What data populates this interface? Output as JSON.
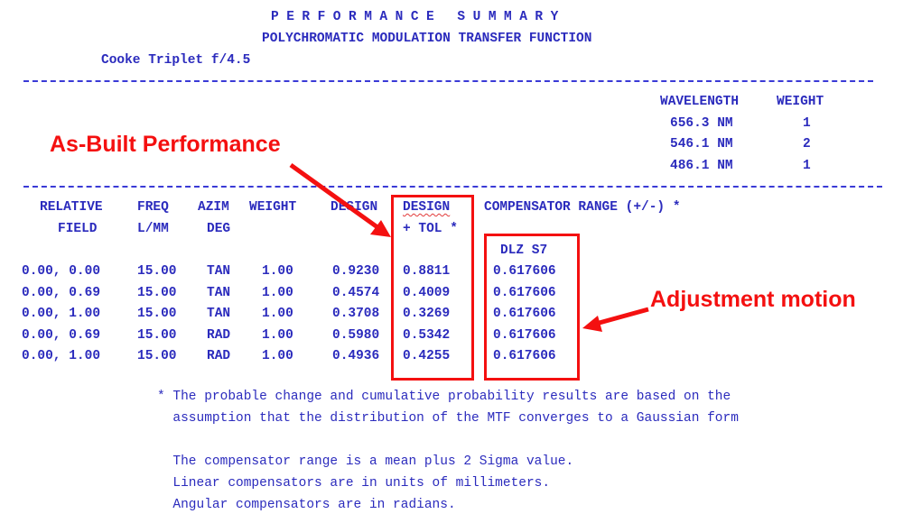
{
  "header": {
    "title": "PERFORMANCE SUMMARY",
    "subtitle": "POLYCHROMATIC MODULATION TRANSFER FUNCTION",
    "lens": "Cooke Triplet f/4.5"
  },
  "wavelengths": {
    "headers": [
      "WAVELENGTH",
      "WEIGHT"
    ],
    "rows": [
      {
        "wavelength": "656.3 NM",
        "weight": "1"
      },
      {
        "wavelength": "546.1 NM",
        "weight": "2"
      },
      {
        "wavelength": "486.1 NM",
        "weight": "1"
      }
    ]
  },
  "table": {
    "headers_line1": [
      "RELATIVE",
      "FREQ",
      "AZIM",
      "WEIGHT",
      "DESIGN",
      "DESIGN",
      "COMPENSATOR RANGE (+/-) *"
    ],
    "headers_line2": [
      "FIELD",
      "L/MM",
      "DEG",
      "",
      "",
      "+ TOL *",
      ""
    ],
    "compensator_name": "DLZ S7",
    "rows": [
      {
        "field": "0.00, 0.00",
        "freq": "15.00",
        "azim": "TAN",
        "weight": "1.00",
        "design": "0.9230",
        "design_tol": "0.8811",
        "comp": "0.617606"
      },
      {
        "field": "0.00, 0.69",
        "freq": "15.00",
        "azim": "TAN",
        "weight": "1.00",
        "design": "0.4574",
        "design_tol": "0.4009",
        "comp": "0.617606"
      },
      {
        "field": "0.00, 1.00",
        "freq": "15.00",
        "azim": "TAN",
        "weight": "1.00",
        "design": "0.3708",
        "design_tol": "0.3269",
        "comp": "0.617606"
      },
      {
        "field": "0.00, 0.69",
        "freq": "15.00",
        "azim": "RAD",
        "weight": "1.00",
        "design": "0.5980",
        "design_tol": "0.5342",
        "comp": "0.617606"
      },
      {
        "field": "0.00, 1.00",
        "freq": "15.00",
        "azim": "RAD",
        "weight": "1.00",
        "design": "0.4936",
        "design_tol": "0.4255",
        "comp": "0.617606"
      }
    ]
  },
  "notes": [
    "* The probable change and cumulative probability results are based on the",
    "  assumption that the distribution of the MTF converges to a Gaussian form",
    "",
    "  The compensator range is a mean plus 2 Sigma value.",
    "  Linear compensators are in units of millimeters.",
    "  Angular compensators are in radians."
  ],
  "annotations": {
    "as_built": "As-Built Performance",
    "adjustment": "Adjustment motion",
    "color": "#f41010"
  },
  "colors": {
    "text": "#2b2bbd",
    "highlight": "#f41010"
  }
}
